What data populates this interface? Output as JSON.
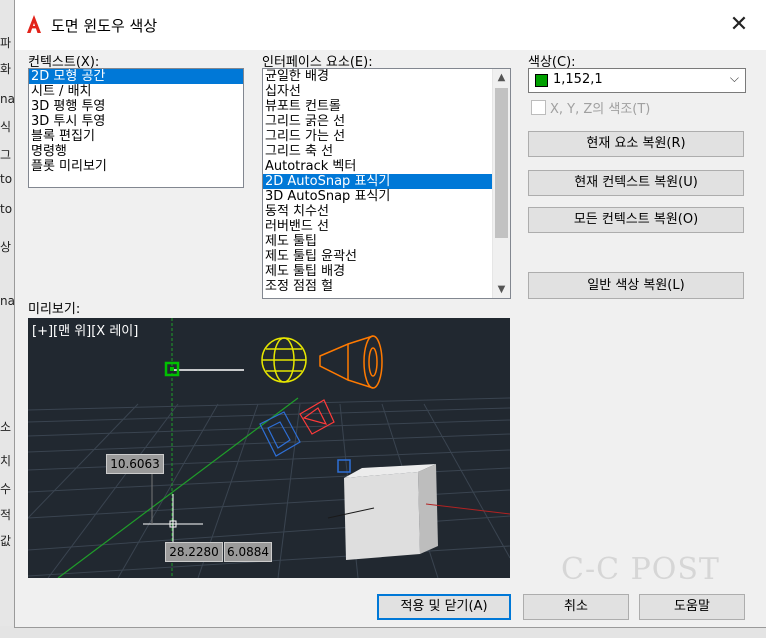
{
  "background": {
    "strip_letters": [
      "파",
      "화",
      "na",
      "식",
      "그",
      "to",
      "to",
      "상",
      "na",
      "소",
      "치",
      "수",
      "적",
      "값"
    ]
  },
  "dialog": {
    "title": "도면 윈도우 색상",
    "close_glyph": "✕"
  },
  "context": {
    "label": "컨텍스트(X):",
    "items": [
      "2D 모형 공간",
      "시트 / 배치",
      "3D 평행 투영",
      "3D 투시 투영",
      "블록 편집기",
      "명령행",
      "플롯 미리보기"
    ],
    "selected_index": 0
  },
  "interface": {
    "label": "인터페이스 요소(E):",
    "items": [
      "균일한 배경",
      "십자선",
      "뷰포트 컨트롤",
      "그리드 굵은 선",
      "그리드 가는 선",
      "그리드 축 선",
      "Autotrack 벡터",
      "2D AutoSnap 표식기",
      "3D AutoSnap 표식기",
      "동적 치수선",
      "러버밴드 선",
      "제도 툴팁",
      "제도 툴팁 윤곽선",
      "제도 툴팁 배경",
      "조정 점점 헐"
    ],
    "selected_index": 7
  },
  "color": {
    "label": "색상(C):",
    "value": "1,152,1",
    "swatch": "#00a000",
    "checkbox_label": "X, Y, Z의 색조(T)",
    "checkbox_checked": false,
    "checkbox_enabled": false
  },
  "buttons": {
    "restore_element": "현재 요소 복원(R)",
    "restore_context": "현재 컨텍스트 복원(U)",
    "restore_all_contexts": "모든 컨텍스트 복원(O)",
    "restore_classic": "일반 색상 복원(L)",
    "apply_close": "적용 및 닫기(A)",
    "cancel": "취소",
    "help": "도움말"
  },
  "preview": {
    "label": "미리보기:",
    "viewport_label": "[+][맨 위][X 레이]",
    "dim1": "10.6063",
    "dim2": "28.2280",
    "dim3": "6.0884"
  },
  "watermark": "C-C POST"
}
